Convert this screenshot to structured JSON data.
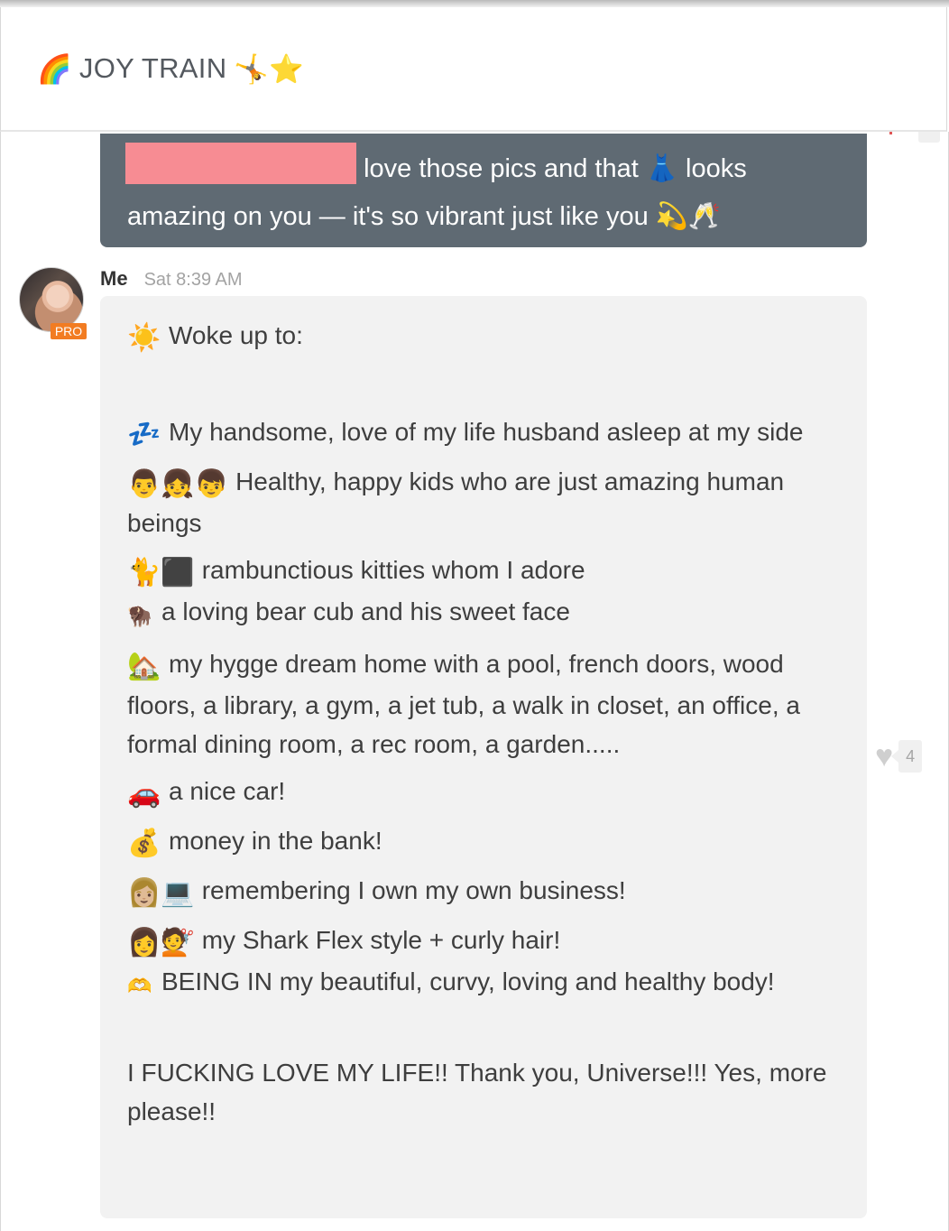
{
  "header": {
    "emoji_left": "🌈",
    "title": "JOY TRAIN",
    "emoji_right": "🤸⭐"
  },
  "previous_message": {
    "line1_text": "love those pics and that",
    "line1_emoji": "👗",
    "line1_end": "looks",
    "line2_text": "amazing on you — it's so vibrant just like you",
    "line2_emoji": "💫🥂",
    "redaction_color": "#f78c93",
    "bubble_color": "#5f6a73"
  },
  "message": {
    "author": "Me",
    "time": "Sat 8:39 AM",
    "badge": "PRO",
    "badge_color": "#f27c22",
    "lines": [
      {
        "icon": "☀️",
        "icon_name": "sun-icon",
        "text": "Woke up to:"
      },
      {
        "icon": "💤",
        "icon_name": "zzz-icon",
        "text": "My handsome, love of my life husband asleep at my side"
      },
      {
        "icon": "👨👧👦",
        "icon_name": "kids-icon",
        "text": "Healthy, happy kids who are just amazing human beings"
      },
      {
        "icon": "🐈⬛",
        "icon_name": "cats-icon",
        "text": "rambunctious kitties whom I adore"
      },
      {
        "icon": "🦬",
        "icon_name": "bison-icon",
        "text": "a loving bear cub and his sweet face"
      },
      {
        "icon": "🏡",
        "icon_name": "house-icon",
        "text": "my hygge dream home with a pool, french doors, wood floors, a library, a gym, a jet tub, a walk in closet, an office, a formal dining room, a rec room, a garden....."
      },
      {
        "icon": "🚗",
        "icon_name": "car-icon",
        "text": "a nice car!"
      },
      {
        "icon": "💰",
        "icon_name": "money-bag-icon",
        "text": "money in the bank!"
      },
      {
        "icon": "👩🏼💻",
        "icon_name": "woman-computer-icon",
        "text": "remembering I own my own business!"
      },
      {
        "icon": "👩💇",
        "icon_name": "woman-hair-icon",
        "text": "my Shark Flex style + curly hair!"
      },
      {
        "icon": "🫶",
        "icon_name": "heart-hands-icon",
        "text": "BEING IN my beautiful, curvy, loving and healthy body!"
      },
      {
        "icon": "",
        "icon_name": "",
        "text": "I FUCKING LOVE MY LIFE!! Thank you, Universe!!! Yes, more please!!"
      }
    ]
  },
  "reaction": {
    "heart": "♥",
    "count": "4"
  }
}
